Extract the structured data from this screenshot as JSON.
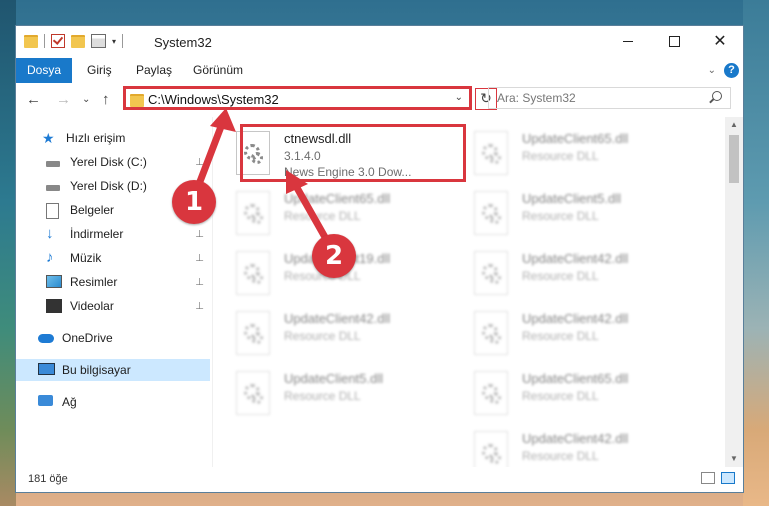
{
  "window": {
    "title": "System32",
    "controls": {
      "minimize": "minimize-icon",
      "maximize": "maximize-icon",
      "close": "✕"
    }
  },
  "ribbon": {
    "tabs": [
      "Dosya",
      "Giriş",
      "Paylaş",
      "Görünüm"
    ],
    "collapse_icon": "chevron-down-icon",
    "help_label": "?"
  },
  "navigation": {
    "back": "←",
    "forward": "→",
    "recent": "⌄",
    "up": "↑",
    "address": "C:\\Windows\\System32",
    "refresh": "↻",
    "search_placeholder": "Ara: System32"
  },
  "sidebar": {
    "items": [
      {
        "label": "Hızlı erişim",
        "icon": "star-icon",
        "pinned": false
      },
      {
        "label": "Yerel Disk (C:)",
        "icon": "drive-icon",
        "pinned": true
      },
      {
        "label": "Yerel Disk (D:)",
        "icon": "drive-icon",
        "pinned": true
      },
      {
        "label": "Belgeler",
        "icon": "document-icon",
        "pinned": true
      },
      {
        "label": "İndirmeler",
        "icon": "download-icon",
        "pinned": true
      },
      {
        "label": "Müzik",
        "icon": "music-icon",
        "pinned": true
      },
      {
        "label": "Resimler",
        "icon": "pictures-icon",
        "pinned": true
      },
      {
        "label": "Videolar",
        "icon": "videos-icon",
        "pinned": true
      },
      {
        "label": "OneDrive",
        "icon": "cloud-icon",
        "pinned": false
      },
      {
        "label": "Bu bilgisayar",
        "icon": "computer-icon",
        "pinned": false,
        "selected": true
      },
      {
        "label": "Ağ",
        "icon": "network-icon",
        "pinned": false
      }
    ],
    "pin_glyph": "📌"
  },
  "files": {
    "highlighted": {
      "name": "ctnewsdl.dll",
      "version": "3.1.4.0",
      "description": "News Engine 3.0 Dow..."
    },
    "column_left": [
      {
        "name": "UpdateClient65.dll",
        "type": "Resource DLL"
      },
      {
        "name": "UpdateClient19.dll",
        "type": "Resource DLL"
      },
      {
        "name": "UpdateClient42.dll",
        "type": "Resource DLL"
      },
      {
        "name": "UpdateClient5.dll",
        "type": "Resource DLL"
      }
    ],
    "column_right": [
      {
        "name": "UpdateClient65.dll",
        "type": "Resource DLL"
      },
      {
        "name": "UpdateClient5.dll",
        "type": "Resource DLL"
      },
      {
        "name": "UpdateClient42.dll",
        "type": "Resource DLL"
      },
      {
        "name": "UpdateClient42.dll",
        "type": "Resource DLL"
      },
      {
        "name": "UpdateClient65.dll",
        "type": "Resource DLL"
      },
      {
        "name": "UpdateClient42.dll",
        "type": "Resource DLL"
      }
    ]
  },
  "status": {
    "item_count": "181 öğe"
  },
  "annotations": {
    "step1": "1",
    "step2": "2",
    "color": "#d9363e"
  }
}
